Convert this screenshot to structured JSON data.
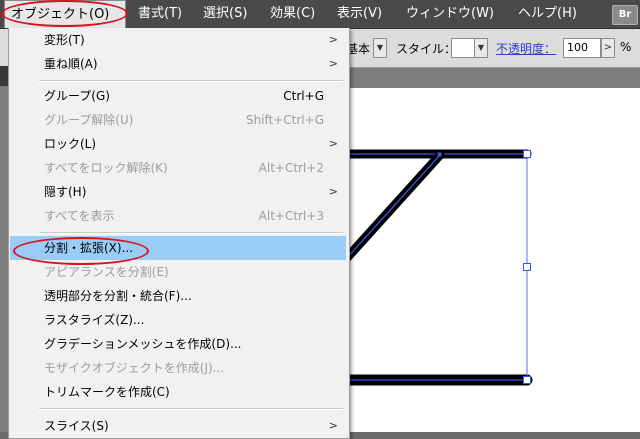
{
  "menubar": {
    "items": [
      {
        "label": "オブジェクト(O)"
      },
      {
        "label": "書式(T)"
      },
      {
        "label": "選択(S)"
      },
      {
        "label": "効果(C)"
      },
      {
        "label": "表示(V)"
      },
      {
        "label": "ウィンドウ(W)"
      },
      {
        "label": "ヘルプ(H)"
      }
    ],
    "bridge_badge": "Br"
  },
  "controlbar": {
    "brush_value": "基本",
    "style_label": "スタイル：",
    "opacity_label": "不透明度：",
    "opacity_value": "100",
    "opacity_unit": "%"
  },
  "object_menu": {
    "items": [
      {
        "label": "変形(T)",
        "shortcut": "",
        "submenu": true,
        "enabled": true
      },
      {
        "label": "重ね順(A)",
        "shortcut": "",
        "submenu": true,
        "enabled": true
      },
      {
        "label": "グループ(G)",
        "shortcut": "Ctrl+G",
        "submenu": false,
        "enabled": true
      },
      {
        "label": "グループ解除(U)",
        "shortcut": "Shift+Ctrl+G",
        "submenu": false,
        "enabled": false
      },
      {
        "label": "ロック(L)",
        "shortcut": "",
        "submenu": true,
        "enabled": true
      },
      {
        "label": "すべてをロック解除(K)",
        "shortcut": "Alt+Ctrl+2",
        "submenu": false,
        "enabled": false
      },
      {
        "label": "隠す(H)",
        "shortcut": "",
        "submenu": true,
        "enabled": true
      },
      {
        "label": "すべてを表示",
        "shortcut": "Alt+Ctrl+3",
        "submenu": false,
        "enabled": false
      },
      {
        "label": "分割・拡張(X)...",
        "shortcut": "",
        "submenu": false,
        "enabled": true,
        "selected": true
      },
      {
        "label": "アピアランスを分割(E)",
        "shortcut": "",
        "submenu": false,
        "enabled": false
      },
      {
        "label": "透明部分を分割・統合(F)...",
        "shortcut": "",
        "submenu": false,
        "enabled": true
      },
      {
        "label": "ラスタライズ(Z)...",
        "shortcut": "",
        "submenu": false,
        "enabled": true
      },
      {
        "label": "グラデーションメッシュを作成(D)...",
        "shortcut": "",
        "submenu": false,
        "enabled": true
      },
      {
        "label": "モザイクオブジェクトを作成(J)...",
        "shortcut": "",
        "submenu": false,
        "enabled": false
      },
      {
        "label": "トリムマークを作成(C)",
        "shortcut": "",
        "submenu": false,
        "enabled": true
      },
      {
        "label": "スライス(S)",
        "shortcut": "",
        "submenu": true,
        "enabled": true
      }
    ]
  },
  "colors": {
    "menubar_bg": "#4a4a4a",
    "menu_bg": "#f1f1f1",
    "selection": "#99ccf7",
    "highlight_ellipse": "#d8121f",
    "path_selection": "#3a56e6"
  }
}
